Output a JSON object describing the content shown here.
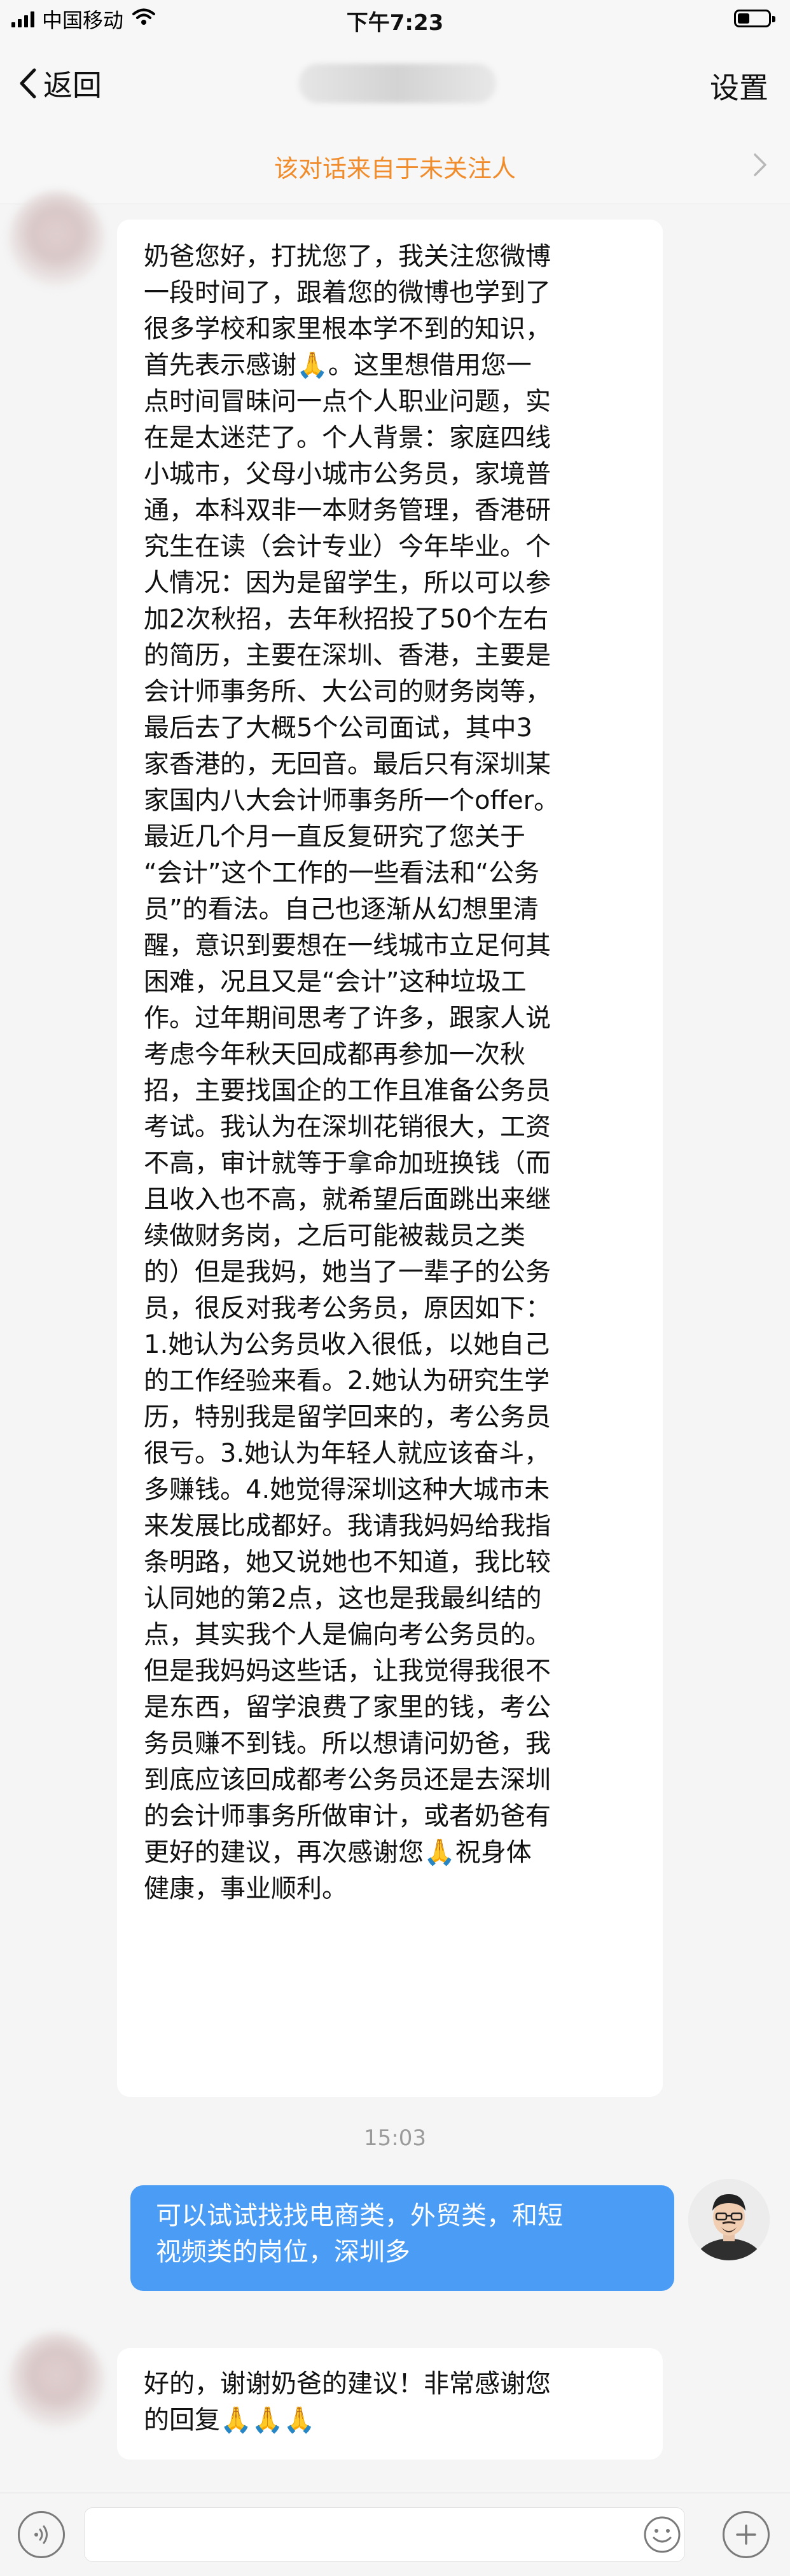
{
  "status_bar": {
    "carrier": "中国移动",
    "time": "下午7:23"
  },
  "nav": {
    "back_label": "返回",
    "settings_label": "设置"
  },
  "notice": {
    "text": "该对话来自于未关注人"
  },
  "messages": [
    {
      "side": "left",
      "lines": [
        "奶爸您好，打扰您了，我关注您微博",
        "一段时间了，跟着您的微博也学到了",
        "很多学校和家里根本学不到的知识，",
        "首先表示感谢🙏。这里想借用您一",
        "点时间冒昧问一点个人职业问题，实",
        "在是太迷茫了。个人背景：家庭四线",
        "小城市，父母小城市公务员，家境普",
        "通，本科双非一本财务管理，香港研",
        "究生在读（会计专业）今年毕业。个",
        "人情况：因为是留学生，所以可以参",
        "加2次秋招，去年秋招投了50个左右",
        "的简历，主要在深圳、香港，主要是",
        "会计师事务所、大公司的财务岗等，",
        "最后去了大概5个公司面试，其中3",
        "家香港的，无回音。最后只有深圳某",
        "家国内八大会计师事务所一个offer。",
        "最近几个月一直反复研究了您关于",
        "“会计”这个工作的一些看法和“公务",
        "员”的看法。自己也逐渐从幻想里清",
        "醒，意识到要想在一线城市立足何其",
        "困难，况且又是“会计”这种垃圾工",
        "作。过年期间思考了许多，跟家人说",
        "考虑今年秋天回成都再参加一次秋",
        "招，主要找国企的工作且准备公务员",
        "考试。我认为在深圳花销很大，工资",
        "不高，审计就等于拿命加班换钱（而",
        "且收入也不高，就希望后面跳出来继",
        "续做财务岗，之后可能被裁员之类",
        "的）但是我妈，她当了一辈子的公务",
        "员，很反对我考公务员，原因如下：",
        "1.她认为公务员收入很低，以她自己",
        "的工作经验来看。2.她认为研究生学",
        "历，特别我是留学回来的，考公务员",
        "很亏。3.她认为年轻人就应该奋斗，",
        "多赚钱。4.她觉得深圳这种大城市未",
        "来发展比成都好。我请我妈妈给我指",
        "条明路，她又说她也不知道，我比较",
        "认同她的第2点，这也是我最纠结的",
        "点，其实我个人是偏向考公务员的。",
        "但是我妈妈这些话，让我觉得我很不",
        "是东西，留学浪费了家里的钱，考公",
        "务员赚不到钱。所以想请问奶爸，我",
        "到底应该回成都考公务员还是去深圳",
        "的会计师事务所做审计，或者奶爸有",
        "更好的建议，再次感谢您🙏祝身体",
        "健康，事业顺利。"
      ]
    },
    {
      "side": "center",
      "time": "15:03"
    },
    {
      "side": "right",
      "lines": [
        "可以试试找找电商类，外贸类，和短",
        "视频类的岗位，深圳多"
      ]
    },
    {
      "side": "left",
      "lines": [
        "好的，谢谢奶爸的建议！非常感谢您",
        "的回复🙏🙏🙏"
      ]
    }
  ],
  "colors": {
    "notice_orange": "#f08c2b",
    "my_bubble_blue": "#4a9cf5",
    "background": "#f5f5f5"
  },
  "icons": [
    "signal-bars-icon",
    "wifi-icon",
    "battery-icon",
    "back-chevron-icon",
    "chevron-right-icon",
    "voice-icon",
    "emoji-icon",
    "plus-icon"
  ]
}
